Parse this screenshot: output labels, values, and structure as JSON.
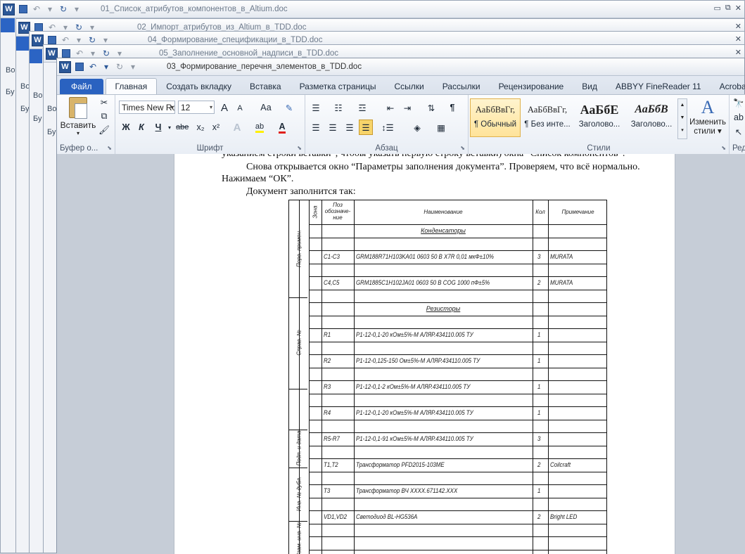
{
  "background_windows": [
    {
      "title": "01_Список_атрибутов_компонентов_в_Altium.doc",
      "side_label": "Во",
      "side_label2": "Бу"
    },
    {
      "title": "02_Импорт_атрибутов_из_Altium_в_TDD.doc",
      "side_label": "Во",
      "side_label2": "Бу"
    },
    {
      "title": "04_Формирование_спецификации_в_TDD.doc",
      "side_label": "Во",
      "side_label2": "Бу"
    },
    {
      "title": "05_Заполнение_основной_надписи_в_TDD.doc",
      "side_label": "Во",
      "side_label2": "Бу"
    }
  ],
  "main_window": {
    "title": "03_Формирование_перечня_элементов_в_TDD.doc",
    "tabs": [
      "Файл",
      "Главная",
      "Создать вкладку",
      "Вставка",
      "Разметка страницы",
      "Ссылки",
      "Рассылки",
      "Рецензирование",
      "Вид",
      "ABBYY FineReader 11",
      "Acrobat"
    ],
    "active_tab": "Главная"
  },
  "ribbon": {
    "clipboard": {
      "paste_label": "Вставить",
      "group_label": "Буфер о..."
    },
    "font": {
      "font_name": "Times New Rc",
      "font_size": "12",
      "case_label": "Аа",
      "group_label": "Шрифт",
      "bold": "Ж",
      "italic": "К",
      "underline": "Ч",
      "strike": "abe",
      "sub": "x₂",
      "sup": "x²",
      "grow": "A",
      "shrink": "A"
    },
    "paragraph": {
      "group_label": "Абзац"
    },
    "styles": {
      "group_label": "Стили",
      "items": [
        {
          "sample": "АаБбВвГг,",
          "name": "¶ Обычный"
        },
        {
          "sample": "АаБбВвГг,",
          "name": "¶ Без инте..."
        },
        {
          "sample": "АаБбЕ",
          "name": "Заголово..."
        },
        {
          "sample": "АаБбВ",
          "name": "Заголово..."
        }
      ],
      "change_label_1": "Изменить",
      "change_label_2": "стили"
    },
    "edit_group_label": "Ред"
  },
  "document": {
    "line_cut": "указанием строки вставки”, чтобы указать первую строку вставки) окна “Список компонентов”.",
    "para1": "Снова открывается окно “Параметры заполнения документа”. Проверяем, что всё нормально. Нажимаем “ОК”.",
    "para2": "Документ заполнится так:"
  },
  "spec_table": {
    "headers": {
      "zone": "Зона",
      "pos": "Поз обозначе-ние",
      "name": "Наименование",
      "qty": "Кол",
      "note": "Примечание"
    },
    "side_labels": [
      "Перв. примен.",
      "Справ. №",
      "Подп. и дата",
      "Инв. № дубл.",
      "Взам. инв. №"
    ],
    "rows": [
      {
        "pos": "",
        "name": "Конденсаторы",
        "qty": "",
        "note": "",
        "section": true
      },
      {
        "pos": "",
        "name": "",
        "qty": "",
        "note": ""
      },
      {
        "pos": "C1-C3",
        "name": "GRM188R71H103KA01 0603 50 В X7R 0,01 мкФ±10%",
        "qty": "3",
        "note": "MURATA"
      },
      {
        "pos": "",
        "name": "",
        "qty": "",
        "note": ""
      },
      {
        "pos": "C4,C5",
        "name": "GRM1885C1H102JA01 0603 50 В COG 1000 пФ±5%",
        "qty": "2",
        "note": "MURATA"
      },
      {
        "pos": "",
        "name": "",
        "qty": "",
        "note": ""
      },
      {
        "pos": "",
        "name": "Резисторы",
        "qty": "",
        "note": "",
        "section": true
      },
      {
        "pos": "",
        "name": "",
        "qty": "",
        "note": ""
      },
      {
        "pos": "R1",
        "name": "Р1-12-0,1-20 кОм±5%-М АЛЯР.434110.005 ТУ",
        "qty": "1",
        "note": ""
      },
      {
        "pos": "",
        "name": "",
        "qty": "",
        "note": ""
      },
      {
        "pos": "R2",
        "name": "Р1-12-0,125-150 Ом±5%-М АЛЯР.434110.005 ТУ",
        "qty": "1",
        "note": ""
      },
      {
        "pos": "",
        "name": "",
        "qty": "",
        "note": ""
      },
      {
        "pos": "R3",
        "name": "Р1-12-0,1-2 кОм±5%-М АЛЯР.434110.005 ТУ",
        "qty": "1",
        "note": ""
      },
      {
        "pos": "",
        "name": "",
        "qty": "",
        "note": ""
      },
      {
        "pos": "R4",
        "name": "Р1-12-0,1-20 кОм±5%-М АЛЯР.434110.005 ТУ",
        "qty": "1",
        "note": ""
      },
      {
        "pos": "",
        "name": "",
        "qty": "",
        "note": ""
      },
      {
        "pos": "R5-R7",
        "name": "Р1-12-0,1-91 кОм±5%-М АЛЯР.434110.005 ТУ",
        "qty": "3",
        "note": ""
      },
      {
        "pos": "",
        "name": "",
        "qty": "",
        "note": ""
      },
      {
        "pos": "T1,T2",
        "name": "Трансформатор PFD2015-103ME",
        "qty": "2",
        "note": "Coilcraft"
      },
      {
        "pos": "",
        "name": "",
        "qty": "",
        "note": ""
      },
      {
        "pos": "T3",
        "name": "Трансформатор ВЧ XXXX.671142.XXX",
        "qty": "1",
        "note": ""
      },
      {
        "pos": "",
        "name": "",
        "qty": "",
        "note": ""
      },
      {
        "pos": "VD1,VD2",
        "name": "Светодиод BL-HG536A",
        "qty": "2",
        "note": "Bright LED"
      },
      {
        "pos": "",
        "name": "",
        "qty": "",
        "note": ""
      },
      {
        "pos": "",
        "name": "",
        "qty": "",
        "note": ""
      }
    ]
  },
  "colors": {
    "file_tab": "#2a62c0",
    "word_icon": "#2b5797",
    "selected_style": "#ffe39a"
  }
}
